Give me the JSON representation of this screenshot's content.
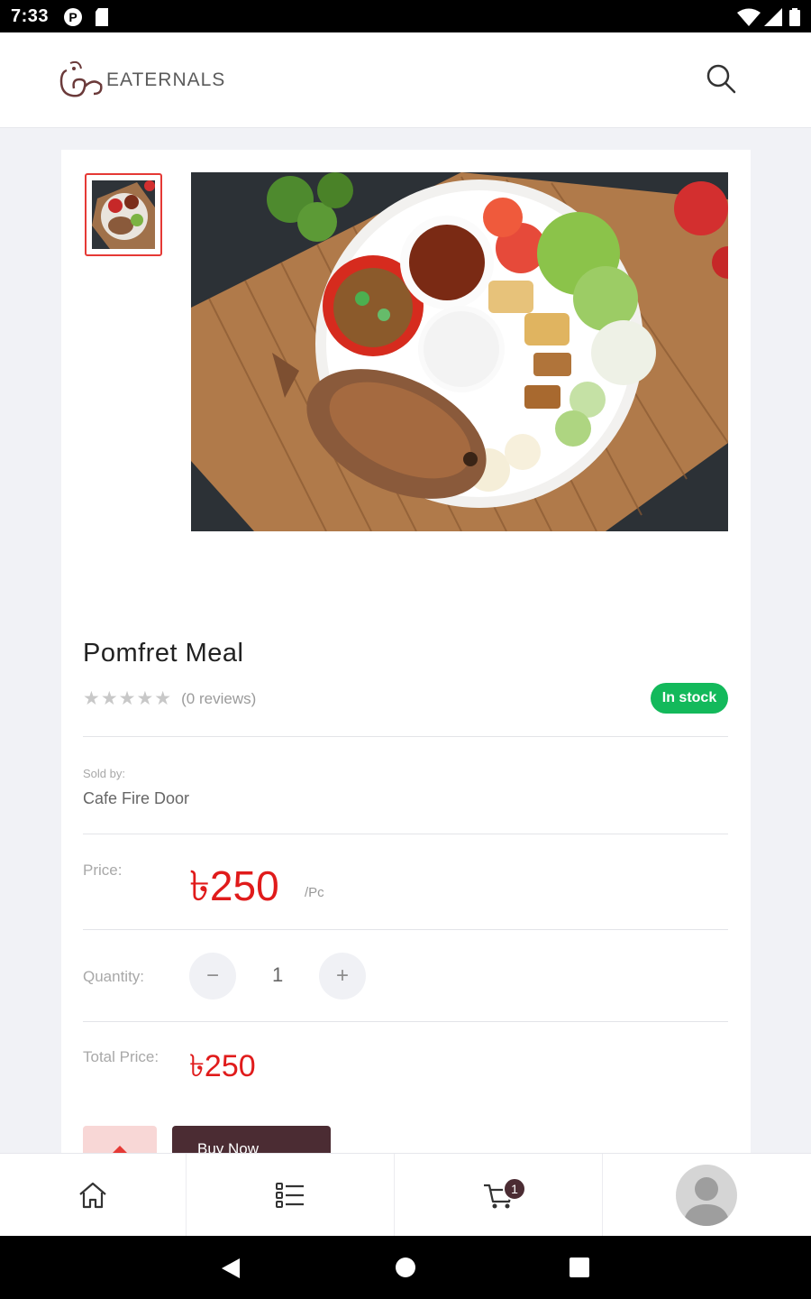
{
  "status_bar": {
    "time": "7:33",
    "icons": [
      "p-notification-icon",
      "sd-card-icon",
      "wifi-icon",
      "signal-icon",
      "battery-icon"
    ]
  },
  "header": {
    "brand": "EATERNALS",
    "search_icon": "search-icon"
  },
  "gallery": {
    "thumbnail_selected": true,
    "photo_alt": "Fried pomfret fish meal with rice, salad, tofu and sauces on a bamboo mat"
  },
  "product": {
    "title": "Pomfret Meal",
    "rating_stars": "★★★★★",
    "rating_value": 0,
    "reviews": "(0 reviews)",
    "stock": "In stock",
    "sold_by_label": "Sold by:",
    "sold_by": "Cafe Fire Door",
    "price_label": "Price:",
    "price": "৳250",
    "price_unit": "/Pc",
    "quantity_label": "Quantity:",
    "quantity": "1",
    "minus": "−",
    "plus": "+",
    "total_label": "Total Price:",
    "total": "৳250"
  },
  "actions": {
    "buy_now": "Buy Now"
  },
  "bottom_nav": {
    "items": [
      "home-icon",
      "categories-icon",
      "cart-icon",
      "profile-avatar"
    ],
    "cart_count": "1"
  },
  "colors": {
    "accent_red": "#e01b1b",
    "in_stock_green": "#13b95b",
    "brand_maroon": "#4b2c33"
  }
}
